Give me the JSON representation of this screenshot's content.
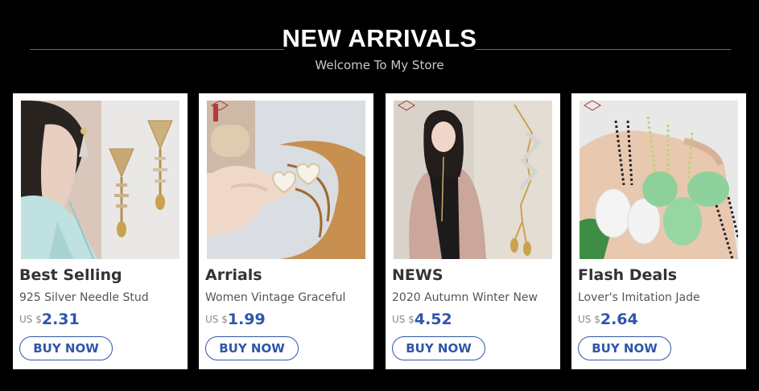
{
  "header": {
    "title": "NEW ARRIVALS",
    "subtitle": "Welcome To My Store"
  },
  "colors": {
    "background": "#000000",
    "accent": "#2f56a8",
    "card": "#ffffff"
  },
  "products": [
    {
      "category": "Best Selling",
      "description": "925 Silver Needle Stud",
      "currency": "US $",
      "price": "2.31",
      "button": "BUY NOW",
      "image": "fish-bone-earrings-photo"
    },
    {
      "category": "Arrials",
      "description": "Women Vintage Graceful",
      "currency": "US $",
      "price": "1.99",
      "button": "BUY NOW",
      "image": "pearl-heart-earrings-photo"
    },
    {
      "category": "NEWS",
      "description": "2020 Autumn Winter New",
      "currency": "US $",
      "price": "4.52",
      "button": "BUY NOW",
      "image": "long-pendant-necklace-photo"
    },
    {
      "category": "Flash Deals",
      "description": "Lover's Imitation Jade",
      "currency": "US $",
      "price": "2.64",
      "button": "BUY NOW",
      "image": "jade-buddha-necklace-photo"
    }
  ]
}
